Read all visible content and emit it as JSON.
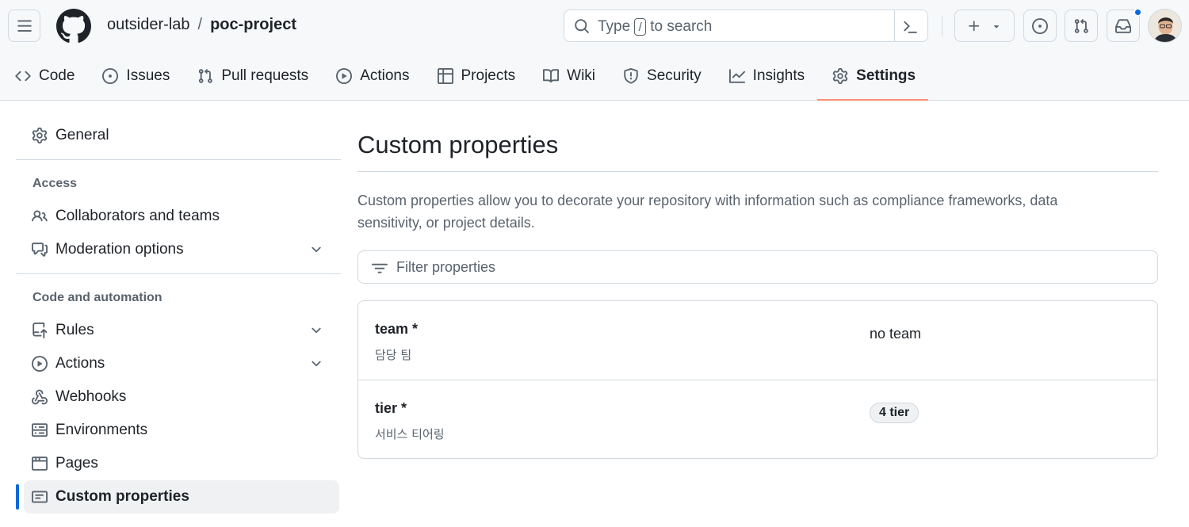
{
  "header": {
    "owner": "outsider-lab",
    "separator": "/",
    "repo": "poc-project",
    "search": {
      "prefix": "Type",
      "key": "/",
      "suffix": "to search"
    },
    "icons": [
      "menu-icon",
      "github-logo",
      "search-icon",
      "command-palette-icon",
      "plus-icon",
      "triangle-down-icon",
      "issue-opened-icon",
      "git-pull-request-icon",
      "inbox-icon"
    ],
    "notification_color": "#0969da"
  },
  "repo_nav": {
    "tabs": [
      {
        "label": "Code",
        "icon": "code-icon"
      },
      {
        "label": "Issues",
        "icon": "issue-opened-icon"
      },
      {
        "label": "Pull requests",
        "icon": "git-pull-request-icon"
      },
      {
        "label": "Actions",
        "icon": "play-icon"
      },
      {
        "label": "Projects",
        "icon": "table-icon"
      },
      {
        "label": "Wiki",
        "icon": "book-icon"
      },
      {
        "label": "Security",
        "icon": "shield-icon"
      },
      {
        "label": "Insights",
        "icon": "graph-icon"
      },
      {
        "label": "Settings",
        "icon": "gear-icon",
        "selected": true
      }
    ],
    "selected_color": "#fd8c73"
  },
  "sidebar": {
    "general": "General",
    "access_heading": "Access",
    "collaborators": "Collaborators and teams",
    "moderation": "Moderation options",
    "code_heading": "Code and automation",
    "rules": "Rules",
    "actions": "Actions",
    "webhooks": "Webhooks",
    "environments": "Environments",
    "pages": "Pages",
    "custom_properties": "Custom properties",
    "selected_color": "#0969da"
  },
  "main": {
    "title": "Custom properties",
    "description": "Custom properties allow you to decorate your repository with information such as compliance frameworks, data sensitivity, or project details.",
    "filter_placeholder": "Filter properties",
    "properties": [
      {
        "name": "team *",
        "description": "담당 팀",
        "value": "no team"
      },
      {
        "name": "tier *",
        "description": "서비스 티어링",
        "value": "4 tier"
      }
    ]
  }
}
